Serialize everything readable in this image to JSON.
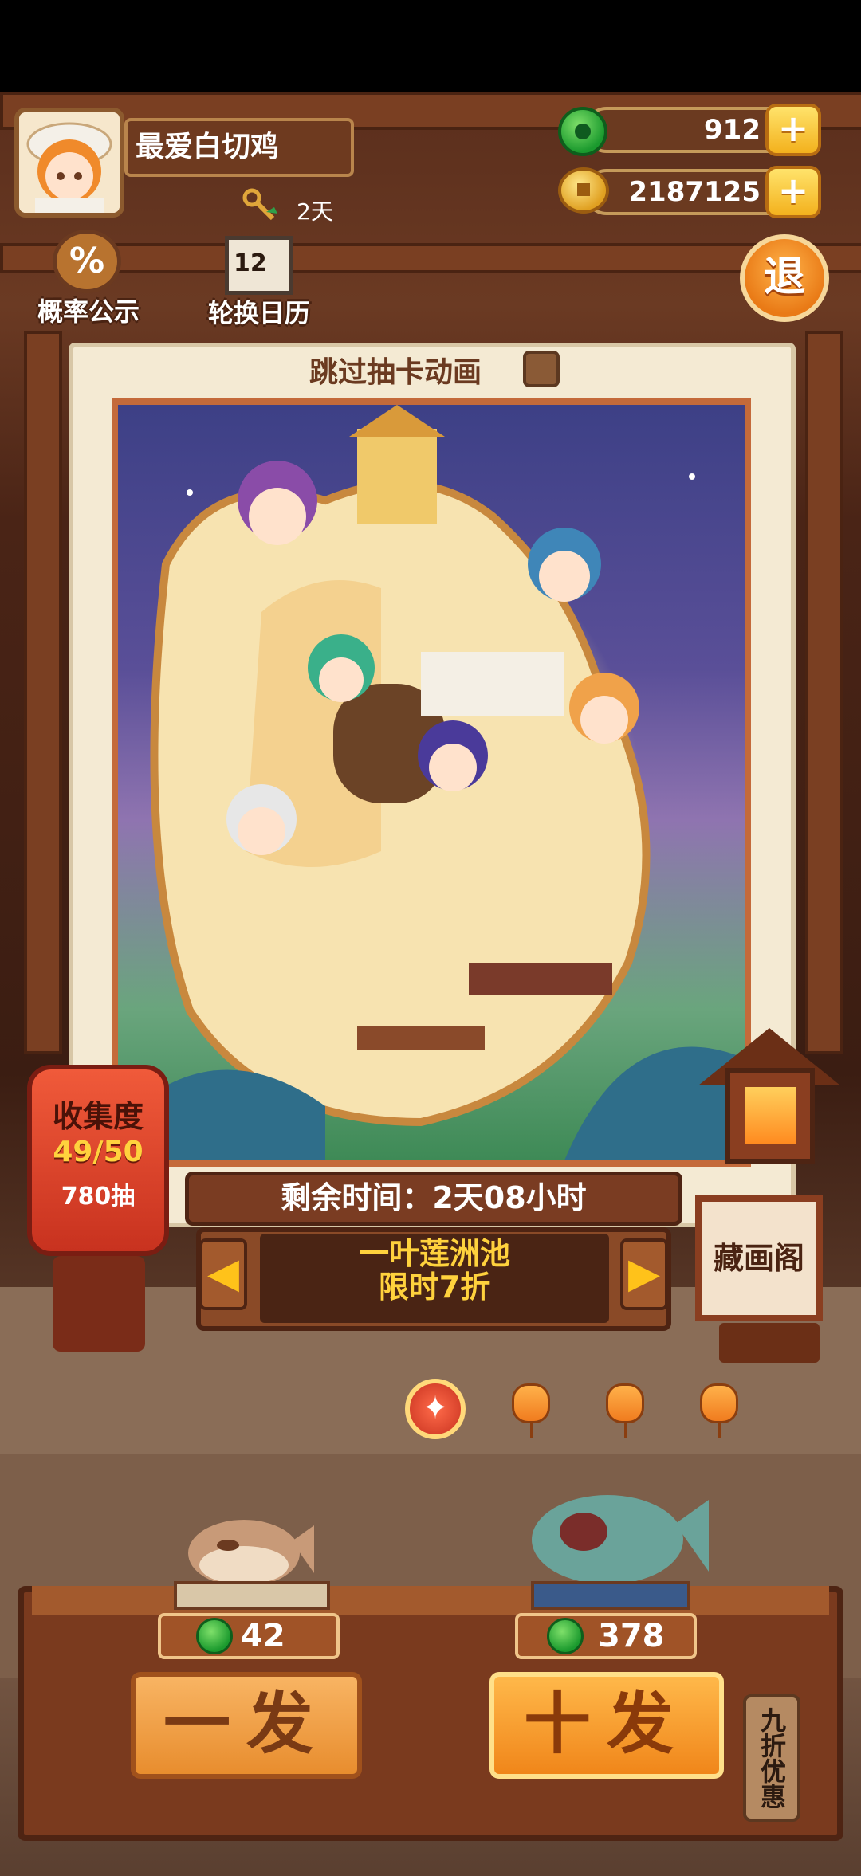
{
  "player": {
    "name": "最爱白切鸡",
    "buff_duration": "2天"
  },
  "resources": {
    "jade": "912",
    "coins": "2187125"
  },
  "top_menu": {
    "probability": "概率公示",
    "calendar": "轮换日历",
    "exit": "退",
    "calendar_day": "12"
  },
  "card": {
    "skip_animation": "跳过抽卡动画"
  },
  "collection": {
    "title": "收集度",
    "progress": "49/50",
    "draws": "780抽"
  },
  "pool": {
    "time_left": "剩余时间：2天08小时",
    "name": "一叶莲洲池",
    "discount": "限时7折"
  },
  "gallery": {
    "label": "藏画阁"
  },
  "draw": {
    "single": {
      "label": "一发",
      "price": "42"
    },
    "ten": {
      "label": "十发",
      "price": "378"
    },
    "discount_tag": "九折优惠"
  },
  "colors": {
    "accent": "#f0861a",
    "jade": "#1b9a2e",
    "gold": "#ffd23d",
    "wood": "#7a3a1e"
  }
}
